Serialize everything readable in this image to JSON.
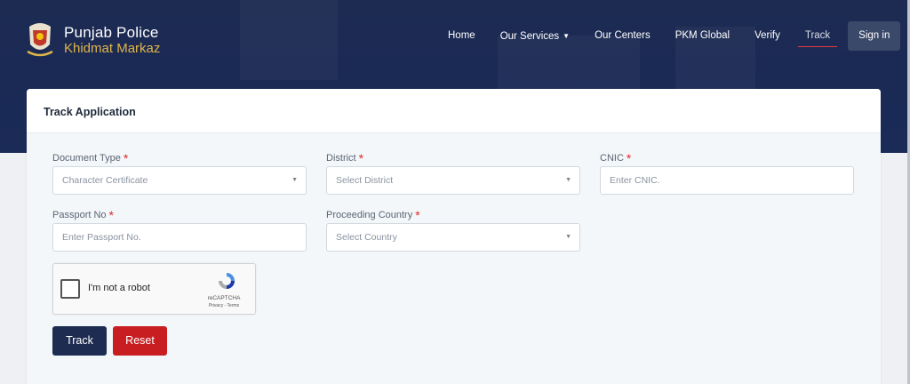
{
  "brand": {
    "line1": "Punjab Police",
    "line2": "Khidmat Markaz"
  },
  "nav": {
    "home": "Home",
    "services": "Our Services",
    "centers": "Our Centers",
    "pkm_global": "PKM Global",
    "verify": "Verify",
    "track": "Track",
    "signin": "Sign in"
  },
  "card": {
    "title": "Track Application"
  },
  "form": {
    "document_type": {
      "label": "Document Type",
      "value": "Character Certificate"
    },
    "district": {
      "label": "District",
      "value": "Select District"
    },
    "cnic": {
      "label": "CNIC",
      "placeholder": "Enter CNIC."
    },
    "passport": {
      "label": "Passport No",
      "placeholder": "Enter Passport No."
    },
    "country": {
      "label": "Proceeding Country",
      "value": "Select Country"
    },
    "required_mark": "*"
  },
  "captcha": {
    "label": "I'm not a robot",
    "brand": "reCAPTCHA",
    "terms": "Privacy - Terms"
  },
  "buttons": {
    "track": "Track",
    "reset": "Reset"
  },
  "colors": {
    "header_bg": "#1d2b52",
    "brand_gold": "#e0b54a",
    "track_button": "#1e2c52",
    "reset_button": "#c81e22",
    "required": "#e0262b",
    "active_underline": "#e03b3b"
  },
  "icons": {
    "emblem": "punjab-police-emblem-icon",
    "dropdown": "chevron-down-icon",
    "recaptcha": "recaptcha-logo-icon"
  }
}
